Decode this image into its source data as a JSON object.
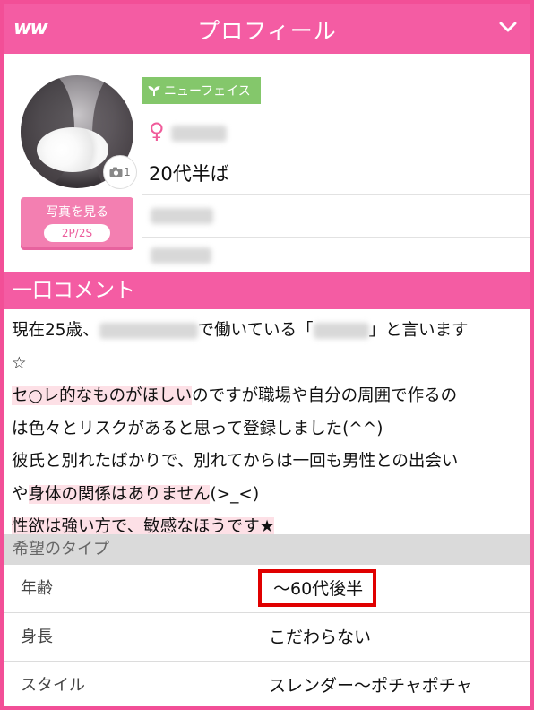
{
  "header": {
    "logo": "ww",
    "title": "プロフィール"
  },
  "profile": {
    "photo_count": "1",
    "photo_button_label": "写真を見る",
    "photo_button_price": "2P/2S",
    "new_face_tag": "ニューフェイス",
    "gender_symbol": "♀",
    "age": "20代半ば"
  },
  "comment_section": {
    "heading": "一口コメント",
    "lines": [
      {
        "pre": "現在25歳、",
        "post": "で働いている「",
        "post2": "」と言います"
      },
      "☆",
      {
        "hl": "セ○レ的なものがほしい",
        "rest": "のですが職場や自分の周囲で作るの"
      },
      "は色々とリスクがあると思って登録しました(^^)",
      "彼氏と別れたばかりで、別れてからは一回も男性との出会い",
      {
        "a": "や",
        "hl": "身体の関係はありません",
        "rest": "(>_<)"
      },
      {
        "hl": "性欲は強い方で、敏感なほうです★"
      }
    ]
  },
  "type_section": {
    "heading": "希望のタイプ",
    "rows": [
      {
        "key": "年齢",
        "value": "～60代後半"
      },
      {
        "key": "身長",
        "value": "こだわらない"
      },
      {
        "key": "スタイル",
        "value": "スレンダー～ポチャポチャ"
      }
    ]
  },
  "colors": {
    "brand_pink": "#f45ca3",
    "new_face_green": "#84c76b",
    "highlight": "#fde0e6",
    "red_box": "#e00000"
  }
}
